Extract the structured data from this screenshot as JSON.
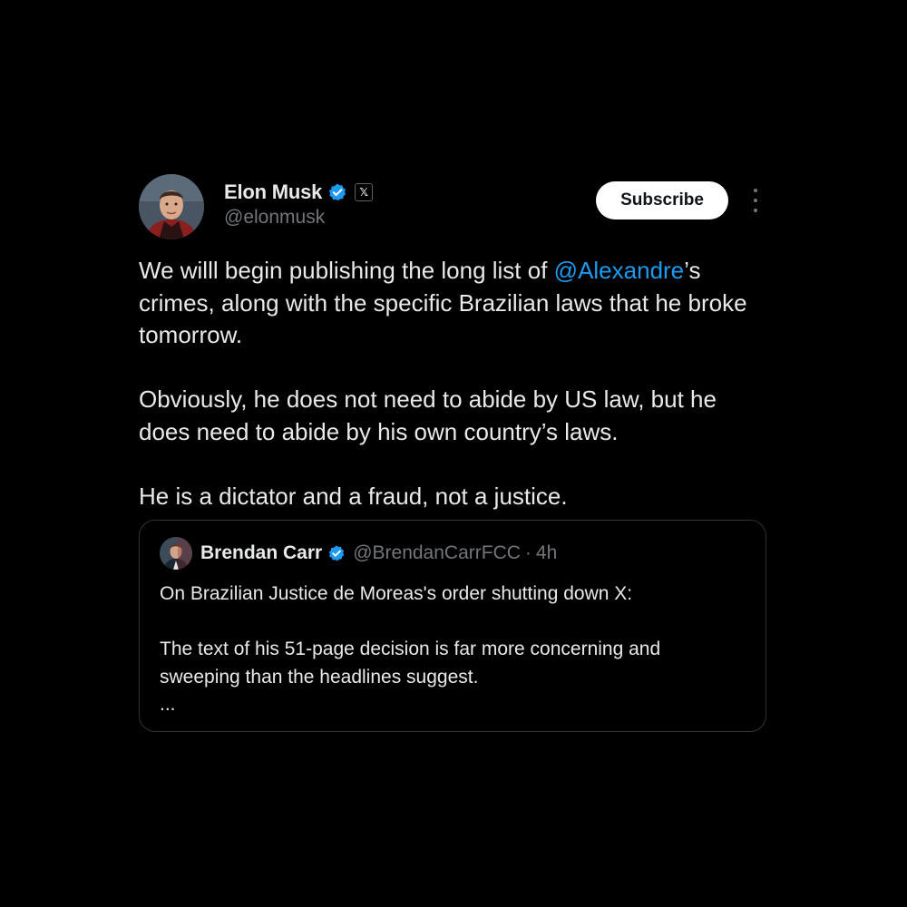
{
  "tweet": {
    "author": {
      "name": "Elon Musk",
      "handle": "@elonmusk",
      "verified": true,
      "affiliate_badge": "𝕏"
    },
    "subscribe_label": "Subscribe",
    "text": {
      "p1_before": "We willl begin publishing the long list of ",
      "p1_mention": "@Alexandre",
      "p1_after": "’s crimes, along with the specific Brazilian laws that he broke tomorrow.",
      "p2": "Obviously, he does not need to abide by US law, but he does need to abide by his own country’s laws.",
      "p3": "He is a dictator and a fraud, not a justice."
    },
    "quote": {
      "author_name": "Brendan Carr",
      "author_handle": "@BrendanCarrFCC",
      "separator": "·",
      "time": "4h",
      "line1": "On Brazilian Justice de Moreas's order shutting down X:",
      "line2": "The text of his 51-page decision is far more concerning and sweeping than the headlines suggest.",
      "line3": "..."
    }
  },
  "icons": {
    "verified": "verified-badge-icon",
    "more": "more-vertical-icon"
  },
  "colors": {
    "background": "#000000",
    "text": "#e7e9ea",
    "secondary": "#71767b",
    "link": "#1d9bf0",
    "verified": "#1d9bf0",
    "border": "#2f3336"
  }
}
